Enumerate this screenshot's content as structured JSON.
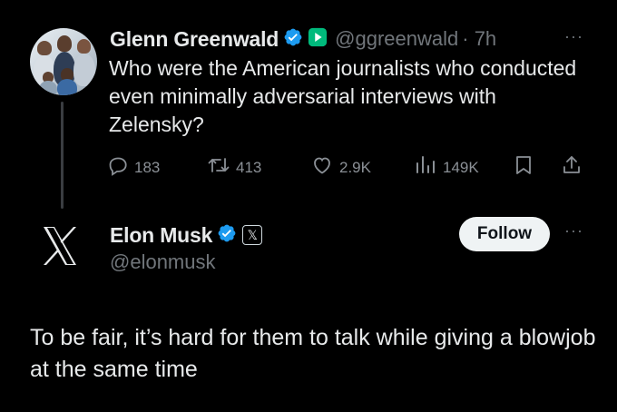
{
  "tweet1": {
    "name": "Glenn Greenwald",
    "handle": "@ggreenwald",
    "time": "· 7h",
    "text": "Who were the American journalists who conducted even minimally adversarial interviews with Zelensky?",
    "more": "···",
    "actions": {
      "replies": "183",
      "retweets": "413",
      "likes": "2.9K",
      "views": "149K"
    }
  },
  "tweet2": {
    "name": "Elon Musk",
    "handle": "@elonmusk",
    "affiliate_badge": "𝕏",
    "follow_label": "Follow",
    "more": "···",
    "text": "To be fair, it’s hard for them to talk while giving a blowjob at the same time"
  },
  "colors": {
    "background": "#000000",
    "text": "#e7e9ea",
    "secondary": "#71767b",
    "verified": "#1d9bf0",
    "follow_bg": "#eff3f4"
  },
  "icons": [
    "verified-badge-icon",
    "subscription-play-icon",
    "reply-icon",
    "retweet-icon",
    "like-icon",
    "views-icon",
    "bookmark-icon",
    "share-icon",
    "x-logo-icon",
    "more-icon"
  ]
}
